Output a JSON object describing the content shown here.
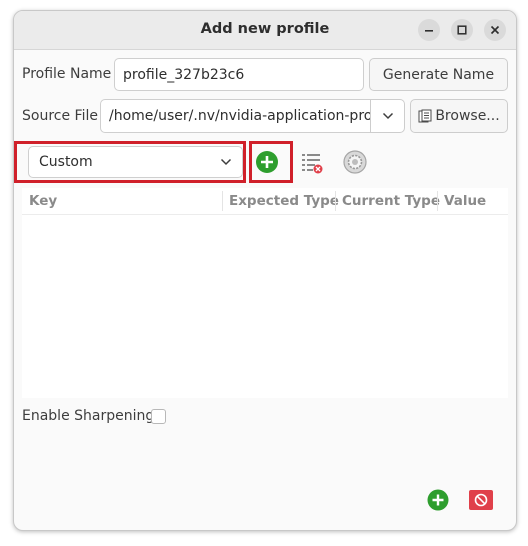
{
  "window": {
    "title": "Add new profile",
    "controls": [
      "minimize-icon",
      "maximize-icon",
      "close-icon"
    ]
  },
  "profile_name": {
    "label": "Profile Name",
    "value": "profile_327b23c6",
    "generate_button": "Generate Name"
  },
  "source_file": {
    "label": "Source File",
    "value": "/home/user/.nv/nvidia-application-pro",
    "browse_button": "Browse...",
    "icons": [
      "chevron-down-icon",
      "folder-icon"
    ]
  },
  "setting_toolbar": {
    "selected_option": "Custom",
    "icons": [
      "chevron-down-icon",
      "add-icon",
      "list-remove-icon",
      "settings-icon"
    ]
  },
  "table": {
    "columns": [
      "Key",
      "Expected Type",
      "Current Type",
      "Value"
    ],
    "rows": []
  },
  "options": {
    "enable_sharpening_label": "Enable Sharpening",
    "enable_sharpening_checked": false
  },
  "footer": {
    "icons": [
      "add-icon",
      "delete-icon"
    ]
  },
  "colors": {
    "highlight": "#d0202a",
    "add_green": "#2e9e2e",
    "delete_red": "#e0404a"
  }
}
